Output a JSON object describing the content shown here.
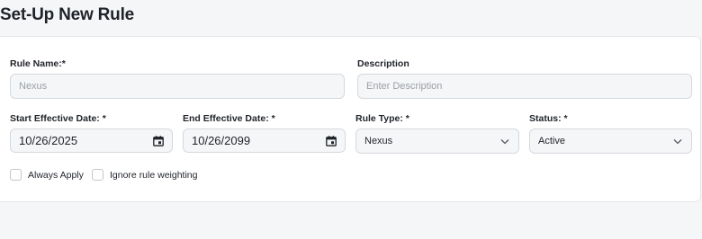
{
  "page": {
    "title": "Set-Up New Rule"
  },
  "form": {
    "rule_name": {
      "label": "Rule Name:*",
      "value": "",
      "placeholder": "Nexus"
    },
    "description": {
      "label": "Description",
      "value": "",
      "placeholder": "Enter Description"
    },
    "start_date": {
      "label": "Start Effective Date: *",
      "value": "10/26/2025"
    },
    "end_date": {
      "label": "End Effective Date: *",
      "value": "10/26/2099"
    },
    "rule_type": {
      "label": "Rule Type: *",
      "value": "Nexus"
    },
    "status": {
      "label": "Status: *",
      "value": "Active"
    },
    "always_apply": {
      "label": "Always Apply",
      "checked": false
    },
    "ignore_weighting": {
      "label": "Ignore rule weighting",
      "checked": false
    }
  },
  "icons": {
    "calendar": "calendar-icon",
    "chevron": "chevron-down-icon"
  }
}
